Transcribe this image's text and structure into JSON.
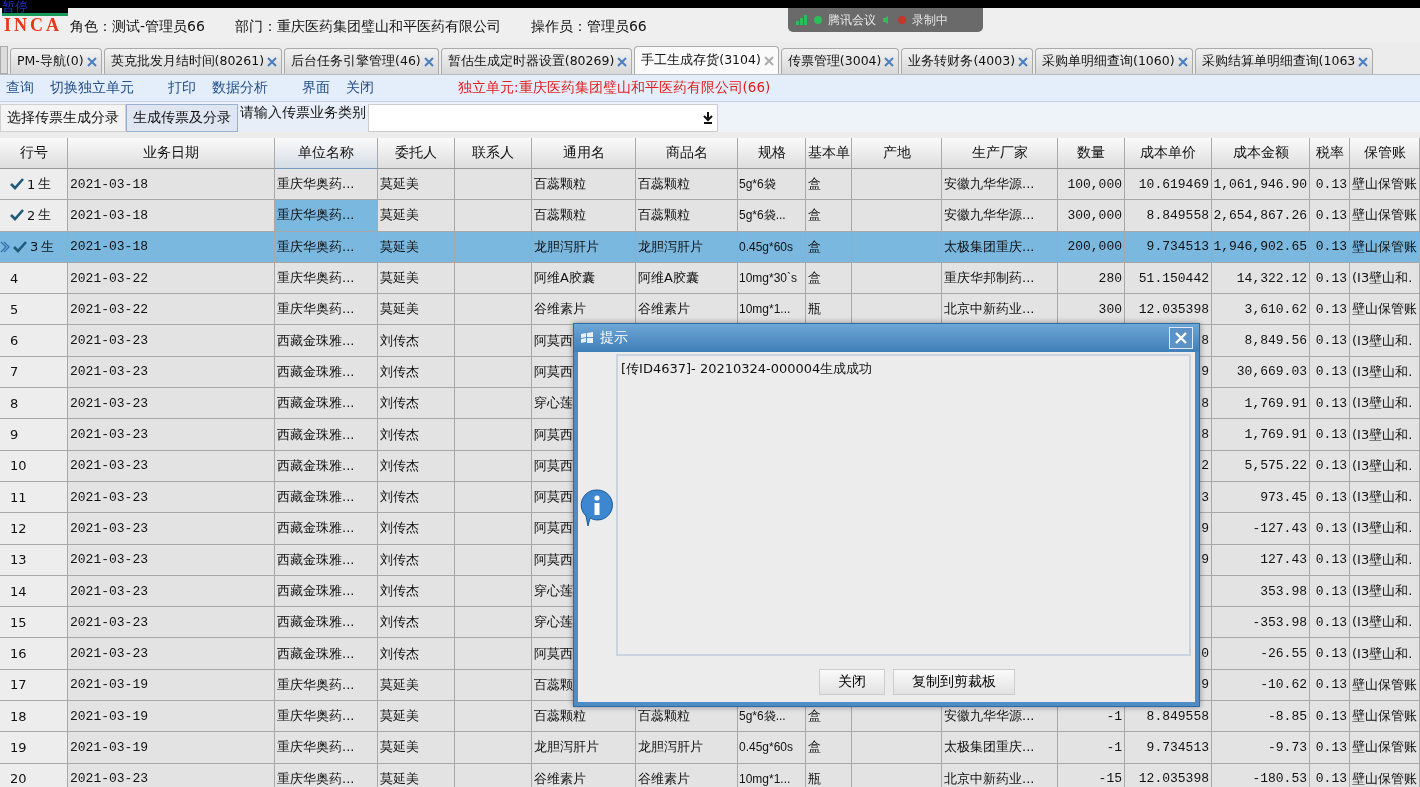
{
  "overlay_label": "暂停",
  "meeting_bar": {
    "app": "腾讯会议",
    "recording": "录制中"
  },
  "header": {
    "logo": "INCA",
    "role": "角色：测试-管理员66",
    "department": "部门：重庆医药集团璧山和平医药有限公司",
    "operator": "操作员：管理员66"
  },
  "tabs": [
    {
      "label": "PM-导航(0)",
      "selected": false
    },
    {
      "label": "英克批发月结时间(80261)",
      "selected": false
    },
    {
      "label": "后台任务引擎管理(46)",
      "selected": false
    },
    {
      "label": "暂估生成定时器设置(80269)",
      "selected": false
    },
    {
      "label": "手工生成存货(3104)",
      "selected": true
    },
    {
      "label": "传票管理(3004)",
      "selected": false
    },
    {
      "label": "业务转财务(4003)",
      "selected": false
    },
    {
      "label": "采购单明细查询(1060)",
      "selected": false
    },
    {
      "label": "采购结算单明细查询(1063",
      "selected": false
    }
  ],
  "menu": [
    [
      "查询",
      "切换独立单元"
    ],
    [
      "打印",
      "数据分析"
    ],
    [
      "界面",
      "关闭"
    ]
  ],
  "unit_label": "独立单元:重庆医药集团璧山和平医药有限公司(66)",
  "toolbar": {
    "buttons": [
      {
        "label": "选择传票生成分录",
        "selected": false
      },
      {
        "label": "生成传票及分录",
        "selected": true
      }
    ],
    "category_label": "请输入传票业务类别"
  },
  "table": {
    "columns": [
      {
        "label": "行号",
        "focused": false
      },
      {
        "label": "业务日期",
        "focused": false
      },
      {
        "label": "单位名称",
        "focused": true
      },
      {
        "label": "委托人",
        "focused": false
      },
      {
        "label": "联系人",
        "focused": false
      },
      {
        "label": "通用名",
        "focused": false
      },
      {
        "label": "商品名",
        "focused": false
      },
      {
        "label": "规格",
        "focused": false
      },
      {
        "label": "基本单",
        "focused": false
      },
      {
        "label": "产地",
        "focused": false
      },
      {
        "label": "生产厂家",
        "focused": false
      },
      {
        "label": "数量",
        "focused": false
      },
      {
        "label": "成本单价",
        "focused": false
      },
      {
        "label": "成本金额",
        "focused": false
      },
      {
        "label": "税率",
        "focused": false
      },
      {
        "label": "保管账",
        "focused": false
      }
    ],
    "rows": [
      {
        "checked": true,
        "selected": false,
        "tag": "生",
        "cells": [
          "1",
          "2021-03-18",
          "重庆华奥药...",
          "莫延美",
          null,
          "百蕊颗粒",
          "百蕊颗粒",
          "5g*6袋",
          "盒",
          null,
          "安徽九华华源...",
          "100,000",
          "10.619469",
          "1,061,946.90",
          "0.13",
          "壁山保管账"
        ]
      },
      {
        "checked": true,
        "selected": false,
        "focused": true,
        "tag": "生",
        "cells": [
          "2",
          "2021-03-18",
          "重庆华奥药...",
          "莫延美",
          null,
          "百蕊颗粒",
          "百蕊颗粒",
          "5g*6袋...",
          "盒",
          null,
          "安徽九华华源...",
          "300,000",
          "8.849558",
          "2,654,867.26",
          "0.13",
          "壁山保管账"
        ]
      },
      {
        "checked": true,
        "selected": true,
        "tag": "生",
        "cells": [
          "3",
          "2021-03-18",
          "重庆华奥药...",
          "莫延美",
          null,
          "龙胆泻肝片",
          "龙胆泻肝片",
          "0.45g*60s",
          "盒",
          null,
          "太极集团重庆...",
          "200,000",
          "9.734513",
          "1,946,902.65",
          "0.13",
          "壁山保管账"
        ]
      },
      {
        "checked": false,
        "selected": false,
        "cells": [
          "4",
          "2021-03-22",
          "重庆华奥药...",
          "莫延美",
          null,
          "阿维A胶囊",
          "阿维A胶囊",
          "10mg*30`s",
          "盒",
          null,
          "重庆华邦制药...",
          "280",
          "51.150442",
          "14,322.12",
          "0.13",
          "(I3壁山和."
        ]
      },
      {
        "checked": false,
        "selected": false,
        "cells": [
          "5",
          "2021-03-22",
          "重庆华奥药...",
          "莫延美",
          null,
          "谷维素片",
          "谷维素片",
          "10mg*1...",
          "瓶",
          null,
          "北京中新药业...",
          "300",
          "12.035398",
          "3,610.62",
          "0.13",
          "壁山保管账"
        ]
      },
      {
        "checked": false,
        "selected": false,
        "cells": [
          "6",
          "2021-03-23",
          "西藏金珠雅...",
          "刘传杰",
          null,
          "阿莫西",
          null,
          null,
          null,
          null,
          null,
          null,
          "8",
          "8,849.56",
          "0.13",
          "(I3壁山和."
        ]
      },
      {
        "checked": false,
        "selected": false,
        "cells": [
          "7",
          "2021-03-23",
          "西藏金珠雅...",
          "刘传杰",
          null,
          "阿莫西",
          null,
          null,
          null,
          null,
          null,
          null,
          "9",
          "30,669.03",
          "0.13",
          "(I3壁山和."
        ]
      },
      {
        "checked": false,
        "selected": false,
        "cells": [
          "8",
          "2021-03-23",
          "西藏金珠雅...",
          "刘传杰",
          null,
          "穿心莲",
          null,
          null,
          null,
          null,
          null,
          null,
          "8",
          "1,769.91",
          "0.13",
          "(I3壁山和."
        ]
      },
      {
        "checked": false,
        "selected": false,
        "cells": [
          "9",
          "2021-03-23",
          "西藏金珠雅...",
          "刘传杰",
          null,
          "阿莫西",
          null,
          null,
          null,
          null,
          null,
          null,
          "8",
          "1,769.91",
          "0.13",
          "(I3壁山和."
        ]
      },
      {
        "checked": false,
        "selected": false,
        "cells": [
          "10",
          "2021-03-23",
          "西藏金珠雅...",
          "刘传杰",
          null,
          "阿莫西",
          null,
          null,
          null,
          null,
          null,
          null,
          "2",
          "5,575.22",
          "0.13",
          "(I3壁山和."
        ]
      },
      {
        "checked": false,
        "selected": false,
        "cells": [
          "11",
          "2021-03-23",
          "西藏金珠雅...",
          "刘传杰",
          null,
          "阿莫西",
          null,
          null,
          null,
          null,
          null,
          null,
          "3",
          "973.45",
          "0.13",
          "(I3壁山和."
        ]
      },
      {
        "checked": false,
        "selected": false,
        "cells": [
          "12",
          "2021-03-23",
          "西藏金珠雅...",
          "刘传杰",
          null,
          "阿莫西",
          null,
          null,
          null,
          null,
          null,
          null,
          "9",
          "-127.43",
          "0.13",
          "(I3壁山和."
        ]
      },
      {
        "checked": false,
        "selected": false,
        "cells": [
          "13",
          "2021-03-23",
          "西藏金珠雅...",
          "刘传杰",
          null,
          "阿莫西",
          null,
          null,
          null,
          null,
          null,
          null,
          "9",
          "127.43",
          "0.13",
          "(I3壁山和."
        ]
      },
      {
        "checked": false,
        "selected": false,
        "cells": [
          "14",
          "2021-03-23",
          "西藏金珠雅...",
          "刘传杰",
          null,
          "穿心莲",
          null,
          null,
          null,
          null,
          null,
          null,
          null,
          "353.98",
          "0.13",
          "(I3壁山和."
        ]
      },
      {
        "checked": false,
        "selected": false,
        "cells": [
          "15",
          "2021-03-23",
          "西藏金珠雅...",
          "刘传杰",
          null,
          "穿心莲",
          null,
          null,
          null,
          null,
          null,
          null,
          null,
          "-353.98",
          "0.13",
          "(I3壁山和."
        ]
      },
      {
        "checked": false,
        "selected": false,
        "cells": [
          "16",
          "2021-03-23",
          "西藏金珠雅...",
          "刘传杰",
          null,
          "阿莫西",
          null,
          null,
          null,
          null,
          null,
          null,
          "0",
          "-26.55",
          "0.13",
          "(I3壁山和."
        ]
      },
      {
        "checked": false,
        "selected": false,
        "cells": [
          "17",
          "2021-03-19",
          "重庆华奥药...",
          "莫延美",
          null,
          "百蕊颗",
          null,
          null,
          null,
          null,
          null,
          null,
          "9",
          "-10.62",
          "0.13",
          "壁山保管账"
        ]
      },
      {
        "checked": false,
        "selected": false,
        "cells": [
          "18",
          "2021-03-19",
          "重庆华奥药...",
          "莫延美",
          null,
          "百蕊颗粒",
          "百蕊颗粒",
          "5g*6袋...",
          "盒",
          null,
          "安徽九华华源...",
          "-1",
          "8.849558",
          "-8.85",
          "0.13",
          "壁山保管账"
        ]
      },
      {
        "checked": false,
        "selected": false,
        "cells": [
          "19",
          "2021-03-19",
          "重庆华奥药...",
          "莫延美",
          null,
          "龙胆泻肝片",
          "龙胆泻肝片",
          "0.45g*60s",
          "盒",
          null,
          "太极集团重庆...",
          "-1",
          "9.734513",
          "-9.73",
          "0.13",
          "壁山保管账"
        ]
      },
      {
        "checked": false,
        "selected": false,
        "cells": [
          "20",
          "2021-03-23",
          "重庆华奥药...",
          "莫延美",
          null,
          "谷维素片",
          "谷维素片",
          "10mg*1...",
          "瓶",
          null,
          "北京中新药业...",
          "-15",
          "12.035398",
          "-180.53",
          "0.13",
          "壁山保管账"
        ]
      }
    ]
  },
  "dialog": {
    "title": "提示",
    "message": "[传ID4637]- 20210324-000004生成成功",
    "buttons": [
      "关闭",
      "复制到剪裁板"
    ]
  }
}
